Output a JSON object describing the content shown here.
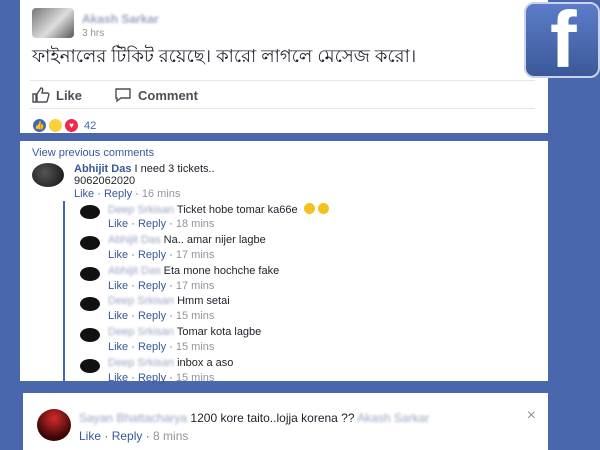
{
  "post": {
    "author": "Akash Sarkar",
    "time": "3 hrs",
    "text": "ফাইনালের টিকিট রয়েছে। কারো লাগলে মেসেজ করো।",
    "like_label": "Like",
    "comment_label": "Comment",
    "reaction_count": "42"
  },
  "comments": {
    "view_previous": "View previous comments",
    "main": {
      "name": "Abhijit Das",
      "text": "I need 3 tickets..",
      "text2": "9062062020",
      "like": "Like",
      "reply": "Reply",
      "time": "16 mins"
    },
    "replies": [
      {
        "name": "Deep Srkisan",
        "text": "Ticket hobe tomar ka66e",
        "like": "Like",
        "reply": "Reply",
        "time": "18 mins"
      },
      {
        "name": "Abhijit Das",
        "text": "Na.. amar nijer lagbe",
        "like": "Like",
        "reply": "Reply",
        "time": "17 mins"
      },
      {
        "name": "Abhijit Das",
        "text": "Eta mone hochche fake",
        "like": "Like",
        "reply": "Reply",
        "time": "17 mins"
      },
      {
        "name": "Deep Srkisan",
        "text": "Hmm setai",
        "like": "Like",
        "reply": "Reply",
        "time": "15 mins"
      },
      {
        "name": "Deep Srkisan",
        "text": "Tomar kota lagbe",
        "like": "Like",
        "reply": "Reply",
        "time": "15 mins"
      },
      {
        "name": "Deep Srkisan",
        "text": "inbox a aso",
        "like": "Like",
        "reply": "Reply",
        "time": "15 mins"
      }
    ]
  },
  "bottom_comment": {
    "name": "Sayan Bhattacharya",
    "text": "1200 kore taito..lojja korena ??",
    "mention": "Akash Sarkar",
    "like": "Like",
    "reply": "Reply",
    "time": "8 mins",
    "close": "×"
  },
  "brand": {
    "logo_letter": "f",
    "accent": "#4267b2"
  }
}
